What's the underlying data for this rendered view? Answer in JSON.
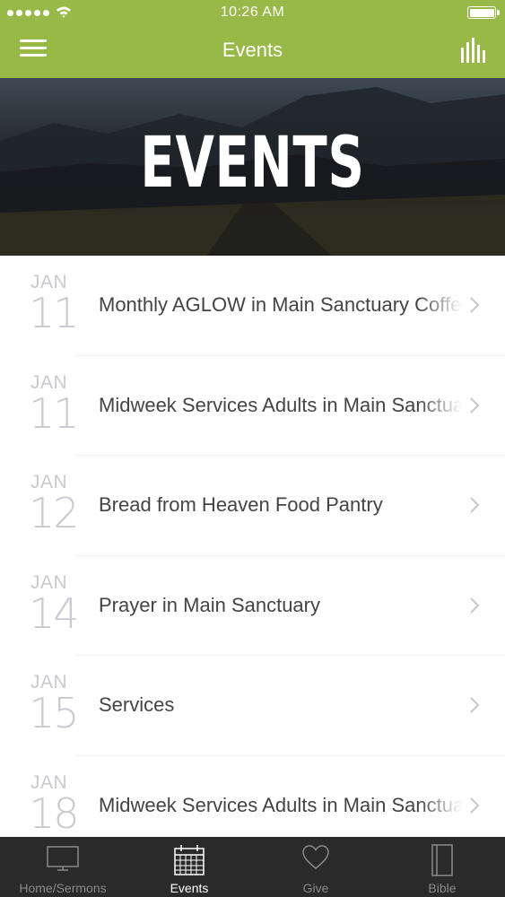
{
  "status_bar": {
    "time": "10:26 AM"
  },
  "navbar": {
    "title": "Events",
    "menu_icon": "hamburger-icon",
    "stats_icon": "bar-chart-icon"
  },
  "hero": {
    "title": "EVENTS"
  },
  "events": [
    {
      "month": "JAN",
      "day": "11",
      "title": "Monthly AGLOW in Main Sanctuary Coffee"
    },
    {
      "month": "JAN",
      "day": "11",
      "title": "Midweek Services Adults in Main Sanctuary"
    },
    {
      "month": "JAN",
      "day": "12",
      "title": "Bread from Heaven Food Pantry"
    },
    {
      "month": "JAN",
      "day": "14",
      "title": "Prayer in Main Sanctuary"
    },
    {
      "month": "JAN",
      "day": "15",
      "title": "Services"
    },
    {
      "month": "JAN",
      "day": "18",
      "title": "Midweek Services Adults in Main Sanctuary"
    }
  ],
  "tabs": [
    {
      "label": "Home/Sermons",
      "icon": "tv-icon",
      "active": false
    },
    {
      "label": "Events",
      "icon": "calendar-icon",
      "active": true
    },
    {
      "label": "Give",
      "icon": "heart-icon",
      "active": false
    },
    {
      "label": "Bible",
      "icon": "book-icon",
      "active": false
    }
  ],
  "colors": {
    "accent": "#98b847",
    "tabbar": "#2a2a2a",
    "date_text": "#c9c9d1",
    "title_text": "#444444"
  }
}
